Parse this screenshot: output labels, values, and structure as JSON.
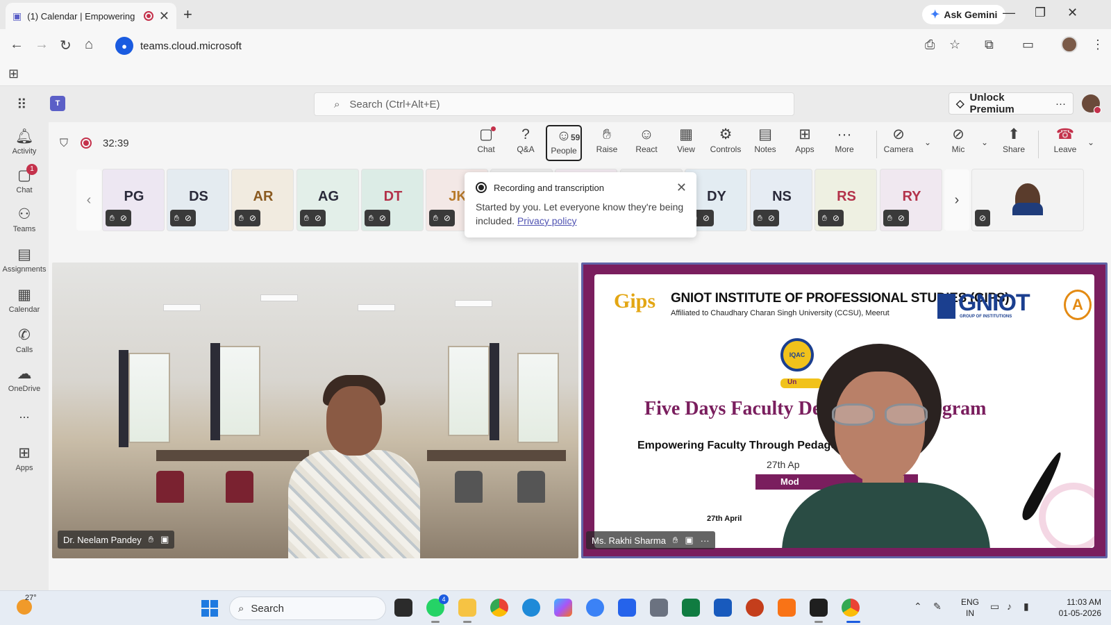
{
  "browser": {
    "tab_title": "(1) Calendar | Empowering",
    "new_tab": "+",
    "close_tab": "✕",
    "gemini_label": "Ask Gemini",
    "url": "teams.cloud.microsoft"
  },
  "teams": {
    "search_placeholder": "Search (Ctrl+Alt+E)",
    "premium_label": "Unlock Premium",
    "premium_more": "···",
    "rail": [
      {
        "label": "Activity",
        "icon": "bell-icon"
      },
      {
        "label": "Chat",
        "icon": "chat-icon",
        "badge": "1"
      },
      {
        "label": "Teams",
        "icon": "teams-icon"
      },
      {
        "label": "Assignments",
        "icon": "assignments-icon"
      },
      {
        "label": "Calendar",
        "icon": "calendar-icon"
      },
      {
        "label": "Calls",
        "icon": "phone-icon"
      },
      {
        "label": "OneDrive",
        "icon": "cloud-icon"
      },
      {
        "label": "...",
        "icon": "more-icon"
      },
      {
        "label": "Apps",
        "icon": "add-app-icon"
      }
    ]
  },
  "meeting": {
    "timer": "32:39",
    "controls": {
      "chat": "Chat",
      "qa": "Q&A",
      "people": "People",
      "people_count": "59",
      "raise": "Raise",
      "react": "React",
      "view": "View",
      "controls": "Controls",
      "notes": "Notes",
      "apps": "Apps",
      "more": "More",
      "camera": "Camera",
      "mic": "Mic",
      "share": "Share",
      "leave": "Leave"
    },
    "participants": [
      "PG",
      "DS",
      "AR",
      "AG",
      "DT",
      "JK",
      "DY",
      "NS",
      "RS",
      "RY"
    ],
    "popup": {
      "title": "Recording and transcription",
      "body": "Started by you. Let everyone know they're being included.",
      "link": "Privacy policy"
    },
    "tiles": [
      {
        "name": "Dr. Neelam Pandey"
      },
      {
        "name": "Ms. Rakhi Sharma"
      }
    ],
    "slide": {
      "logo_left": "Gips",
      "institute": "GNIOT INSTITUTE OF PROFESSIONAL STUDIES (GIPS)",
      "affiliation": "Affiliated to Chaudhary Charan Singh University (CCSU), Meerut",
      "logo_right": "GNIOT",
      "logo_right_sub": "GROUP OF INSTITUTIONS",
      "grade": "A",
      "iqac": "IQAC",
      "badge_fragment": "Un",
      "title": "Five Days Faculty Development Program",
      "subtitle": "Empowering Faculty Through Pedagogical Innovation",
      "date_fragment": "27th Ap",
      "mode_fragment": "Mod",
      "date2_fragment": "27th April"
    }
  },
  "taskbar": {
    "temperature": "27°",
    "search_label": "Search",
    "whatsapp_badge": "4",
    "language_top": "ENG",
    "language_bottom": "IN",
    "time": "11:03 AM",
    "date": "01-05-2026"
  }
}
